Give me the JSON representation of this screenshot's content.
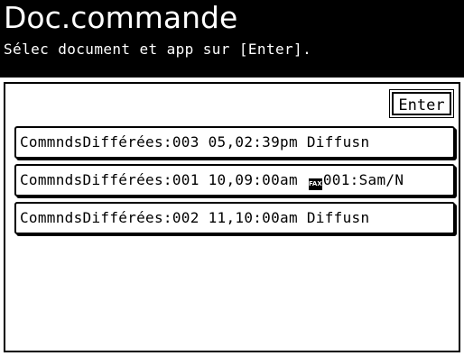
{
  "header": {
    "title": "Doc.commande",
    "subtitle": "Sélec document et app sur [Enter]."
  },
  "toolbar": {
    "enter_label": "Enter"
  },
  "documents": [
    {
      "label": "CommndsDifférées:003 05,02:39pm Diffusn"
    },
    {
      "label_before_icon": "CommndsDifférées:001 10,09:00am ",
      "icon": "fax-icon",
      "icon_text": "FAX",
      "label_after_icon": "001:Sam/N"
    },
    {
      "label": "CommndsDifférées:002 11,10:00am Diffusn"
    }
  ],
  "colors": {
    "header_background": "#000000",
    "header_text": "#ffffff",
    "background": "#ffffff",
    "border": "#000000"
  }
}
